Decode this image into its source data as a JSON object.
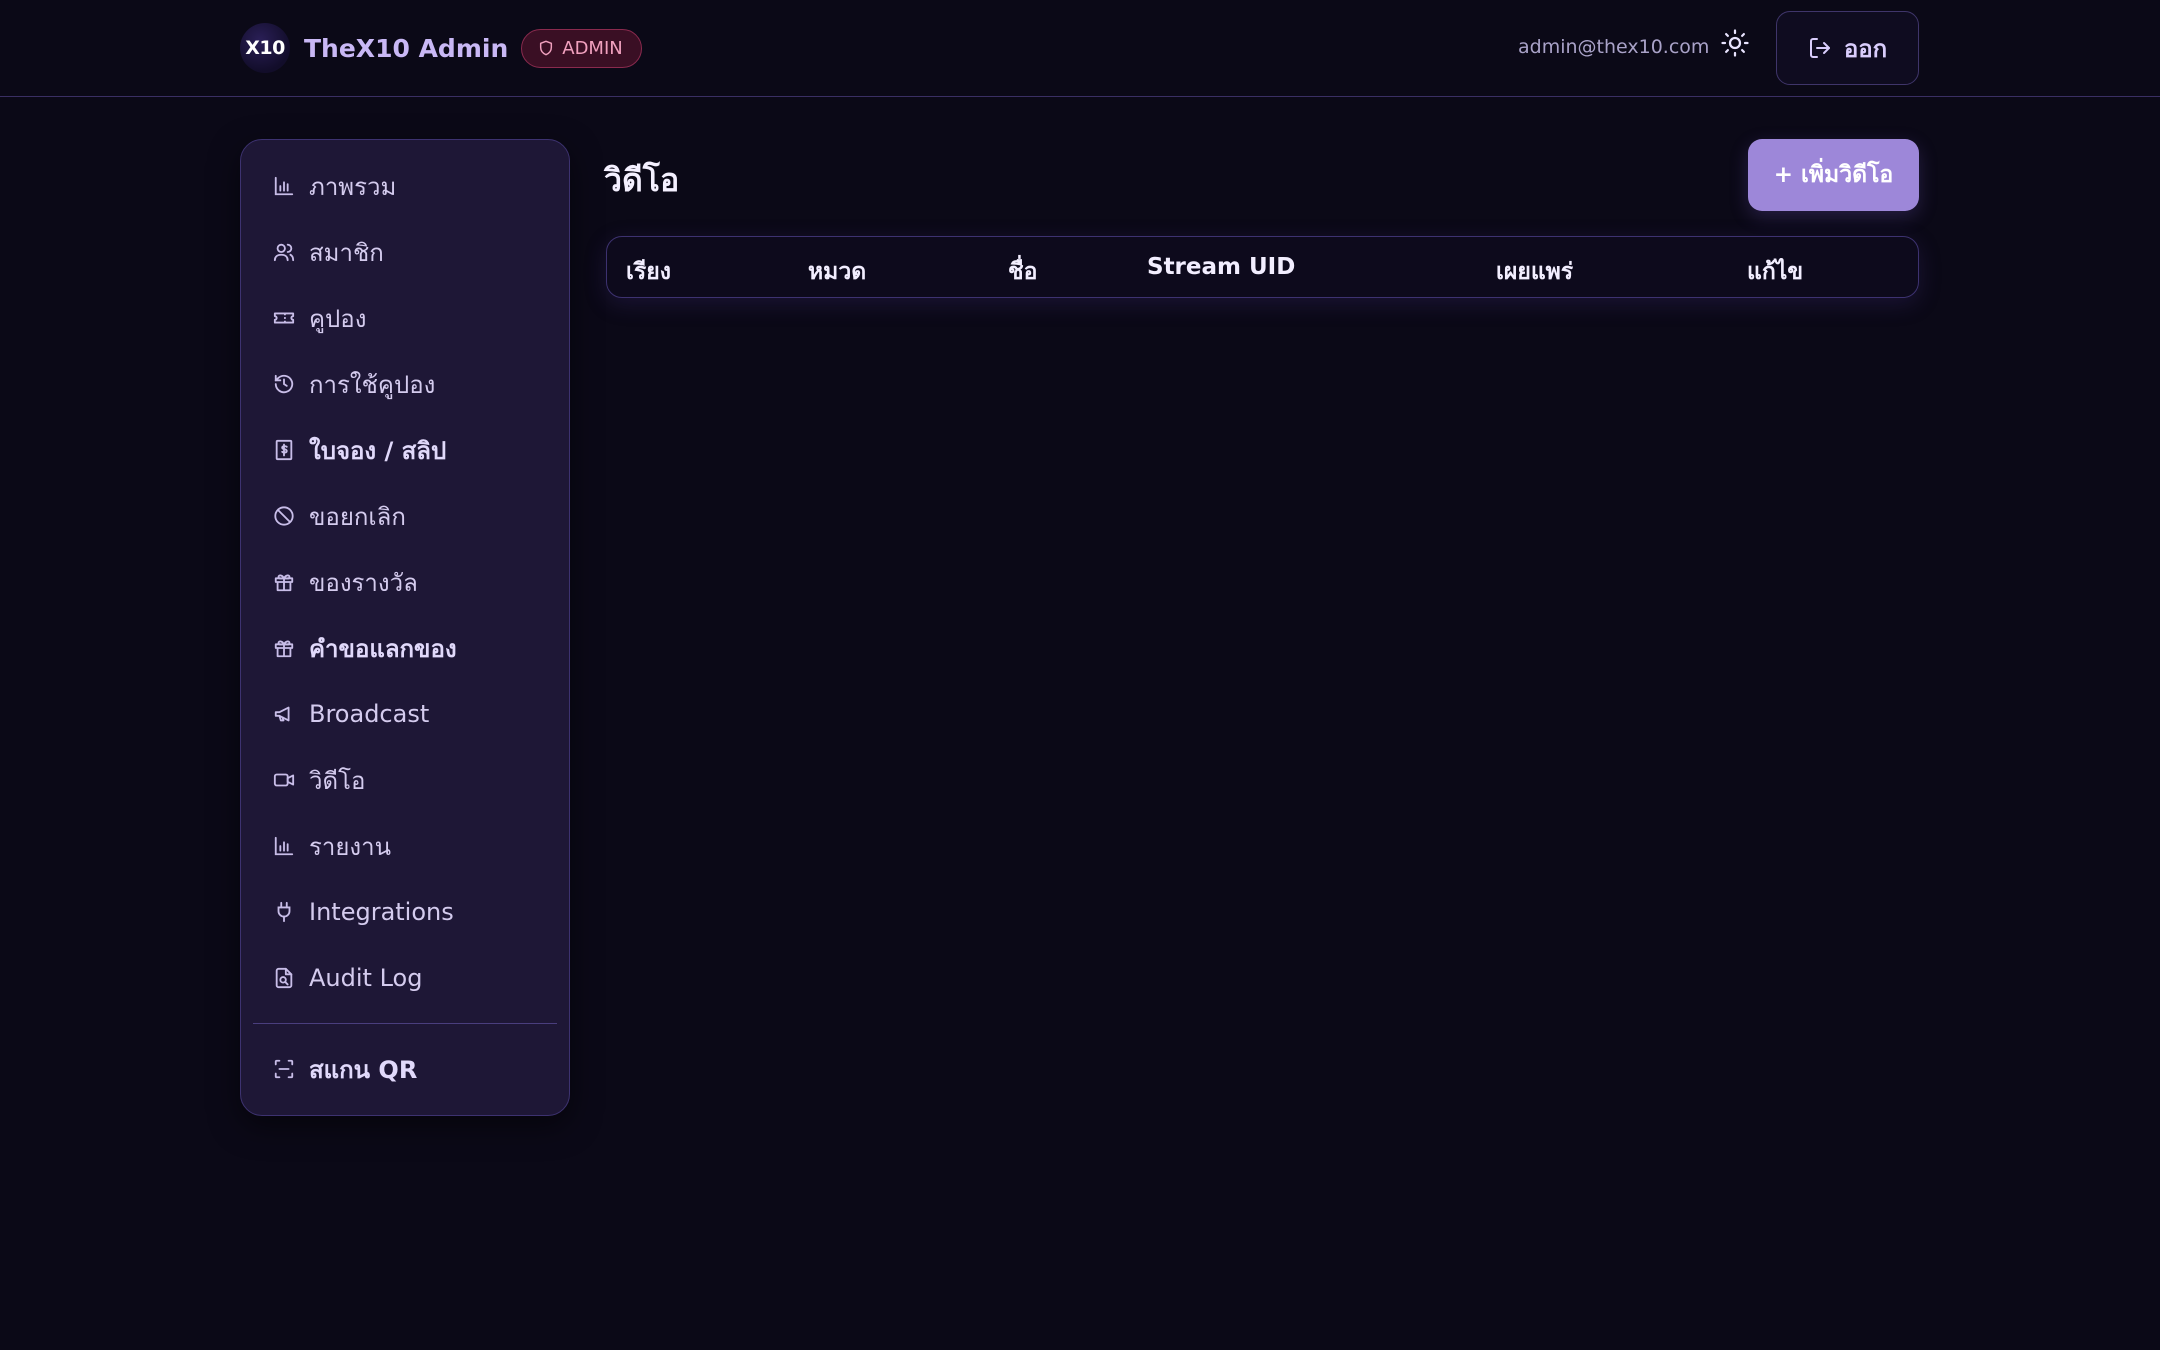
{
  "header": {
    "logo_text": "X10",
    "brand_name": "TheX10 Admin",
    "role_badge": "ADMIN",
    "user_email": "admin@thex10.com",
    "logout_label": "ออก"
  },
  "sidebar": {
    "items": [
      {
        "label": "ภาพรวม",
        "icon": "bar-chart-icon"
      },
      {
        "label": "สมาชิก",
        "icon": "users-icon"
      },
      {
        "label": "คูปอง",
        "icon": "ticket-icon"
      },
      {
        "label": "การใช้คูปอง",
        "icon": "history-icon"
      },
      {
        "label": "ใบจอง / สลิป",
        "icon": "receipt-icon"
      },
      {
        "label": "ขอยกเลิก",
        "icon": "ban-icon"
      },
      {
        "label": "ของรางวัล",
        "icon": "gift-icon"
      },
      {
        "label": "คำขอแลกของ",
        "icon": "gift-icon"
      },
      {
        "label": "Broadcast",
        "icon": "megaphone-icon"
      },
      {
        "label": "วิดีโอ",
        "icon": "video-icon"
      },
      {
        "label": "รายงาน",
        "icon": "bar-chart-icon"
      },
      {
        "label": "Integrations",
        "icon": "plug-icon"
      },
      {
        "label": "Audit Log",
        "icon": "file-search-icon"
      }
    ],
    "scan_qr": {
      "label": "สแกน QR",
      "icon": "scan-icon"
    }
  },
  "main": {
    "title": "วิดีโอ",
    "add_button": "+ เพิ่มวิดีโอ",
    "table": {
      "columns": [
        "เรียง",
        "หมวด",
        "ชื่อ",
        "Stream UID",
        "เผยแพร่",
        "แก้ไข"
      ],
      "rows": []
    }
  },
  "colors": {
    "background": "#0b0917",
    "sidebar_bg": "#1e1736",
    "accent": "#9d87d9",
    "badge_text": "#f0a0be"
  }
}
